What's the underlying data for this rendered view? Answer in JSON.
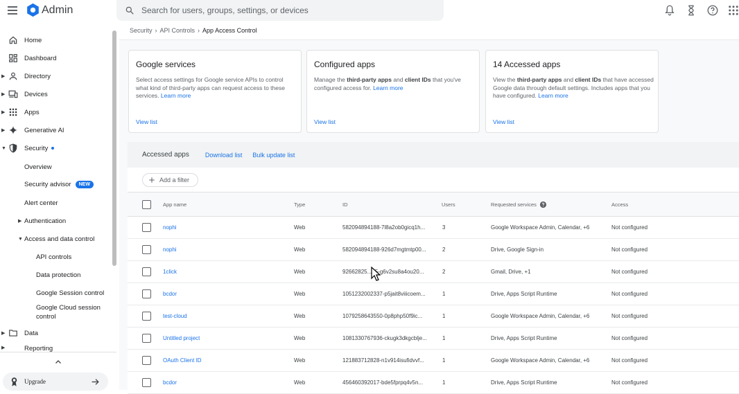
{
  "header": {
    "brand": "Admin",
    "search_placeholder": "Search for users, groups, settings, or devices"
  },
  "sidebar": {
    "items": [
      {
        "label": "Home"
      },
      {
        "label": "Dashboard"
      },
      {
        "label": "Directory"
      },
      {
        "label": "Devices"
      },
      {
        "label": "Apps"
      },
      {
        "label": "Generative AI"
      },
      {
        "label": "Security"
      },
      {
        "label": "Overview"
      },
      {
        "label": "Security advisor",
        "badge": "NEW"
      },
      {
        "label": "Alert center"
      },
      {
        "label": "Authentication"
      },
      {
        "label": "Access and data control"
      },
      {
        "label": "API controls"
      },
      {
        "label": "Data protection"
      },
      {
        "label": "Google Session control"
      },
      {
        "label": "Google Cloud session control"
      },
      {
        "label": "Data"
      },
      {
        "label": "Reporting"
      }
    ],
    "upgrade_label": "Upgrade"
  },
  "breadcrumb": {
    "items": [
      "Security",
      "API Controls",
      "App Access Control"
    ]
  },
  "cards": [
    {
      "title": "Google services",
      "text": "Select access settings for Google service APIs to control what kind of third-party apps can request access to these services.",
      "learn": "Learn more",
      "view": "View list"
    },
    {
      "title": "Configured apps",
      "t1": "Manage the ",
      "b1": "third-party apps",
      "t2": " and ",
      "b2": "client IDs",
      "t3": " that you've configured access for.",
      "learn": "Learn more",
      "view": "View list"
    },
    {
      "title": "14 Accessed apps",
      "t1": "View the ",
      "b1": "third-party apps",
      "t2": " and ",
      "b2": "client IDs",
      "t3": " that have accessed Google data through default settings. Includes apps that you have configured.",
      "learn": "Learn more",
      "view": "View list"
    }
  ],
  "accessed": {
    "title": "Accessed apps",
    "download": "Download list",
    "bulk": "Bulk update list",
    "filter": "Add a filter",
    "columns": [
      "App name",
      "Type",
      "ID",
      "Users",
      "Requested services",
      "Access"
    ],
    "rows": [
      {
        "app": "nophi",
        "type": "Web",
        "id": "582094894188-7l8a2ob0gicq1h...",
        "users": "3",
        "services": "Google Workspace Admin, Calendar, +6",
        "access": "Not configured"
      },
      {
        "app": "nophi",
        "type": "Web",
        "id": "582094894188-926d7mgtmtp00...",
        "users": "2",
        "services": "Drive, Google Sign-in",
        "access": "Not configured"
      },
      {
        "app": "1click",
        "type": "Web",
        "id": "92662825...05-g6v2su8a4ou20...",
        "users": "2",
        "services": "Gmail, Drive, +1",
        "access": "Not configured"
      },
      {
        "app": "bcdor",
        "type": "Web",
        "id": "1051232002337-p5jait8viiicoem...",
        "users": "1",
        "services": "Drive, Apps Script Runtime",
        "access": "Not configured"
      },
      {
        "app": "test-cloud",
        "type": "Web",
        "id": "1079258643550-0p8php50f9ic...",
        "users": "1",
        "services": "Google Workspace Admin, Calendar, +6",
        "access": "Not configured"
      },
      {
        "app": "Untitled project",
        "type": "Web",
        "id": "1081330767936-ckugk3dkgcblje...",
        "users": "1",
        "services": "Drive, Apps Script Runtime",
        "access": "Not configured"
      },
      {
        "app": "OAuth Client ID",
        "type": "Web",
        "id": "121883712828-n1v914isufidvvf...",
        "users": "1",
        "services": "Google Workspace Admin, Calendar, +6",
        "access": "Not configured"
      },
      {
        "app": "bcdor",
        "type": "Web",
        "id": "456460392017-bde5fprpq4v5n...",
        "users": "1",
        "services": "Drive, Apps Script Runtime",
        "access": "Not configured"
      }
    ]
  }
}
